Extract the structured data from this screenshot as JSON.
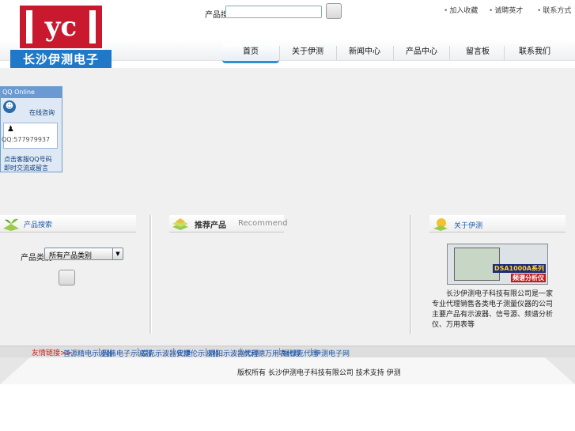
{
  "header": {
    "logo_text": "长沙伊测电子",
    "logo_monogram": "yc",
    "search_label": "产品搜索",
    "search_placeholder": "",
    "search_button_label": "",
    "top_links": [
      {
        "label": "加入收藏"
      },
      {
        "label": "诚聘英才"
      },
      {
        "label": "联系方式"
      }
    ]
  },
  "nav": {
    "tabs": [
      {
        "label": "首页"
      },
      {
        "label": "关于伊测"
      },
      {
        "label": "新闻中心"
      },
      {
        "label": "产品中心"
      },
      {
        "label": "留言板"
      },
      {
        "label": "联系我们"
      }
    ]
  },
  "qq": {
    "header": "QQ Online",
    "consult": "在线咨询",
    "number": "QQ:577979937",
    "footer_line1": "点击客服QQ号码",
    "footer_line2": "即时交流或留言"
  },
  "product_search": {
    "title": "产品搜索",
    "category_label": "产品类别",
    "category_selected": "所有产品类别",
    "go_button_label": ""
  },
  "recommend": {
    "title": "推荐产品",
    "subtitle": "Recommend"
  },
  "about": {
    "title": "关于伊测",
    "image_label_1": "DSA1000A系列",
    "image_label_2": "频谱分析仪",
    "lines": [
      "长沙伊测电子科技有限公司是一家",
      "专业代理销售各类电子测量仪器的公司",
      "主要产品有示波器、信号源、频谱分析",
      "仪、万用表等"
    ]
  },
  "links": {
    "prefix": "友情链接>>",
    "items": [
      {
        "label": "普源精电示波器"
      },
      {
        "label": "固纬电子示波器"
      },
      {
        "label": "泰克示波器代理"
      },
      {
        "label": "安捷伦示波器"
      },
      {
        "label": "鼎阳示波器代理"
      },
      {
        "label": "优利德万用表代理"
      },
      {
        "label": "福禄克代理"
      },
      {
        "label": "伊测电子网"
      }
    ]
  },
  "footer": {
    "text": "版权所有 长沙伊测电子科技有限公司    技术支持 伊测"
  },
  "colors": {
    "logo_red": "#c8192e",
    "logo_blue": "#1f78c8",
    "nav_accent": "#2f8fd0",
    "link_blue": "#1a53a8",
    "link_prefix_red": "#d11b1b"
  }
}
